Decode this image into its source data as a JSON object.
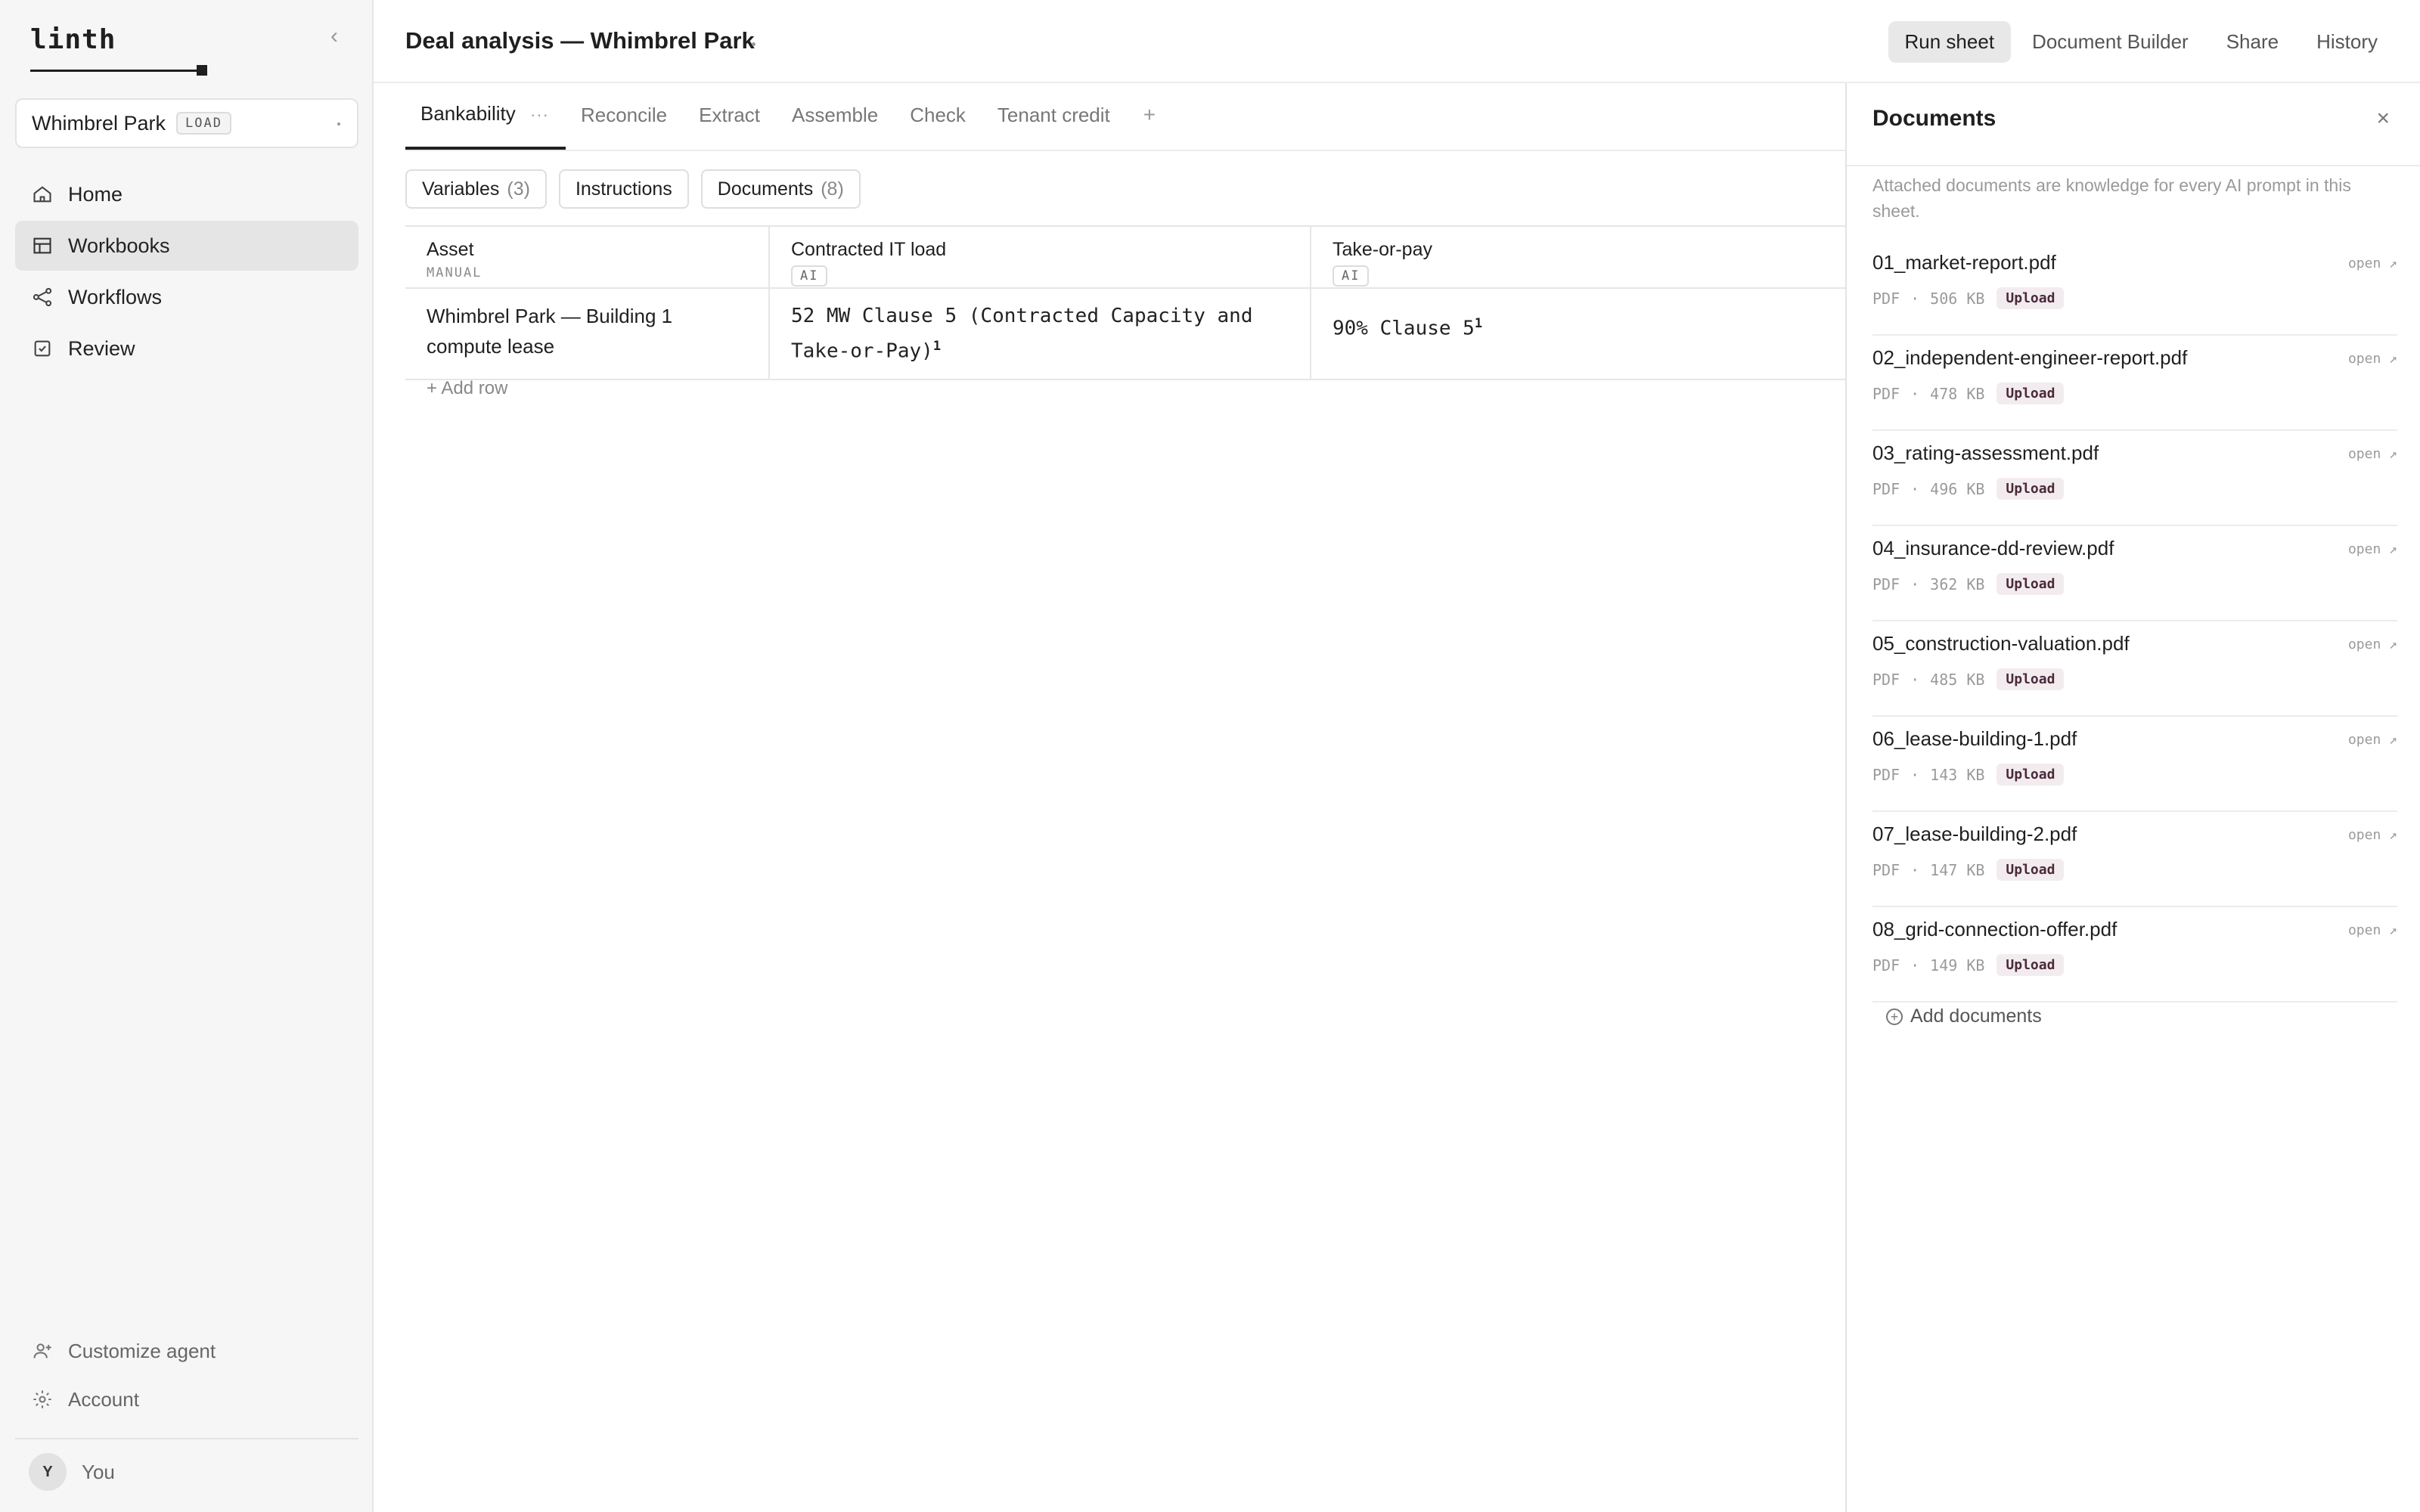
{
  "sidebar": {
    "logo": "linth",
    "workspace": {
      "name": "Whimbrel Park",
      "badge": "LOAD"
    },
    "nav": [
      {
        "label": "Home",
        "icon": "home-icon"
      },
      {
        "label": "Workbooks",
        "icon": "table-icon",
        "active": true
      },
      {
        "label": "Workflows",
        "icon": "share-nodes-icon"
      },
      {
        "label": "Review",
        "icon": "checkbox-icon"
      }
    ],
    "bottom_nav": [
      {
        "label": "Customize agent",
        "icon": "user-plus-icon"
      },
      {
        "label": "Account",
        "icon": "gear-icon"
      }
    ],
    "user": {
      "initial": "Y",
      "name": "You"
    }
  },
  "header": {
    "title": "Deal analysis — Whimbrel Park",
    "actions": [
      "Run sheet",
      "Document Builder",
      "Share",
      "History"
    ]
  },
  "tabs": {
    "items": [
      "Bankability",
      "Reconcile",
      "Extract",
      "Assemble",
      "Check",
      "Tenant credit"
    ],
    "more": "···",
    "add": "+"
  },
  "chips": [
    {
      "label": "Variables",
      "count": "(3)"
    },
    {
      "label": "Instructions",
      "count": ""
    },
    {
      "label": "Documents",
      "count": "(8)"
    }
  ],
  "table": {
    "columns": [
      {
        "label": "Asset",
        "sub": "MANUAL"
      },
      {
        "label": "Contracted IT load",
        "badge": "AI"
      },
      {
        "label": "Take-or-pay",
        "badge": "AI"
      }
    ],
    "rows": [
      {
        "asset": "Whimbrel Park — Building 1 compute lease",
        "it_load": "52 MW Clause 5 (Contracted Capacity and Take-or-Pay)",
        "it_load_ref": "1",
        "take_or_pay": "90% Clause 5",
        "take_or_pay_ref": "1"
      }
    ],
    "add_row": "+ Add row"
  },
  "panel": {
    "title": "Documents",
    "close": "×",
    "description": "Attached documents are knowledge for every AI prompt in this sheet.",
    "documents": [
      {
        "name": "01_market-report.pdf",
        "type": "PDF",
        "size": "506 KB",
        "badge": "Upload",
        "action": "open ↗"
      },
      {
        "name": "02_independent-engineer-report.pdf",
        "type": "PDF",
        "size": "478 KB",
        "badge": "Upload",
        "action": "open ↗"
      },
      {
        "name": "03_rating-assessment.pdf",
        "type": "PDF",
        "size": "496 KB",
        "badge": "Upload",
        "action": "open ↗"
      },
      {
        "name": "04_insurance-dd-review.pdf",
        "type": "PDF",
        "size": "362 KB",
        "badge": "Upload",
        "action": "open ↗"
      },
      {
        "name": "05_construction-valuation.pdf",
        "type": "PDF",
        "size": "485 KB",
        "badge": "Upload",
        "action": "open ↗"
      },
      {
        "name": "06_lease-building-1.pdf",
        "type": "PDF",
        "size": "143 KB",
        "badge": "Upload",
        "action": "open ↗"
      },
      {
        "name": "07_lease-building-2.pdf",
        "type": "PDF",
        "size": "147 KB",
        "badge": "Upload",
        "action": "open ↗"
      },
      {
        "name": "08_grid-connection-offer.pdf",
        "type": "PDF",
        "size": "149 KB",
        "badge": "Upload",
        "action": "open ↗"
      }
    ],
    "add_documents": "Add documents"
  }
}
